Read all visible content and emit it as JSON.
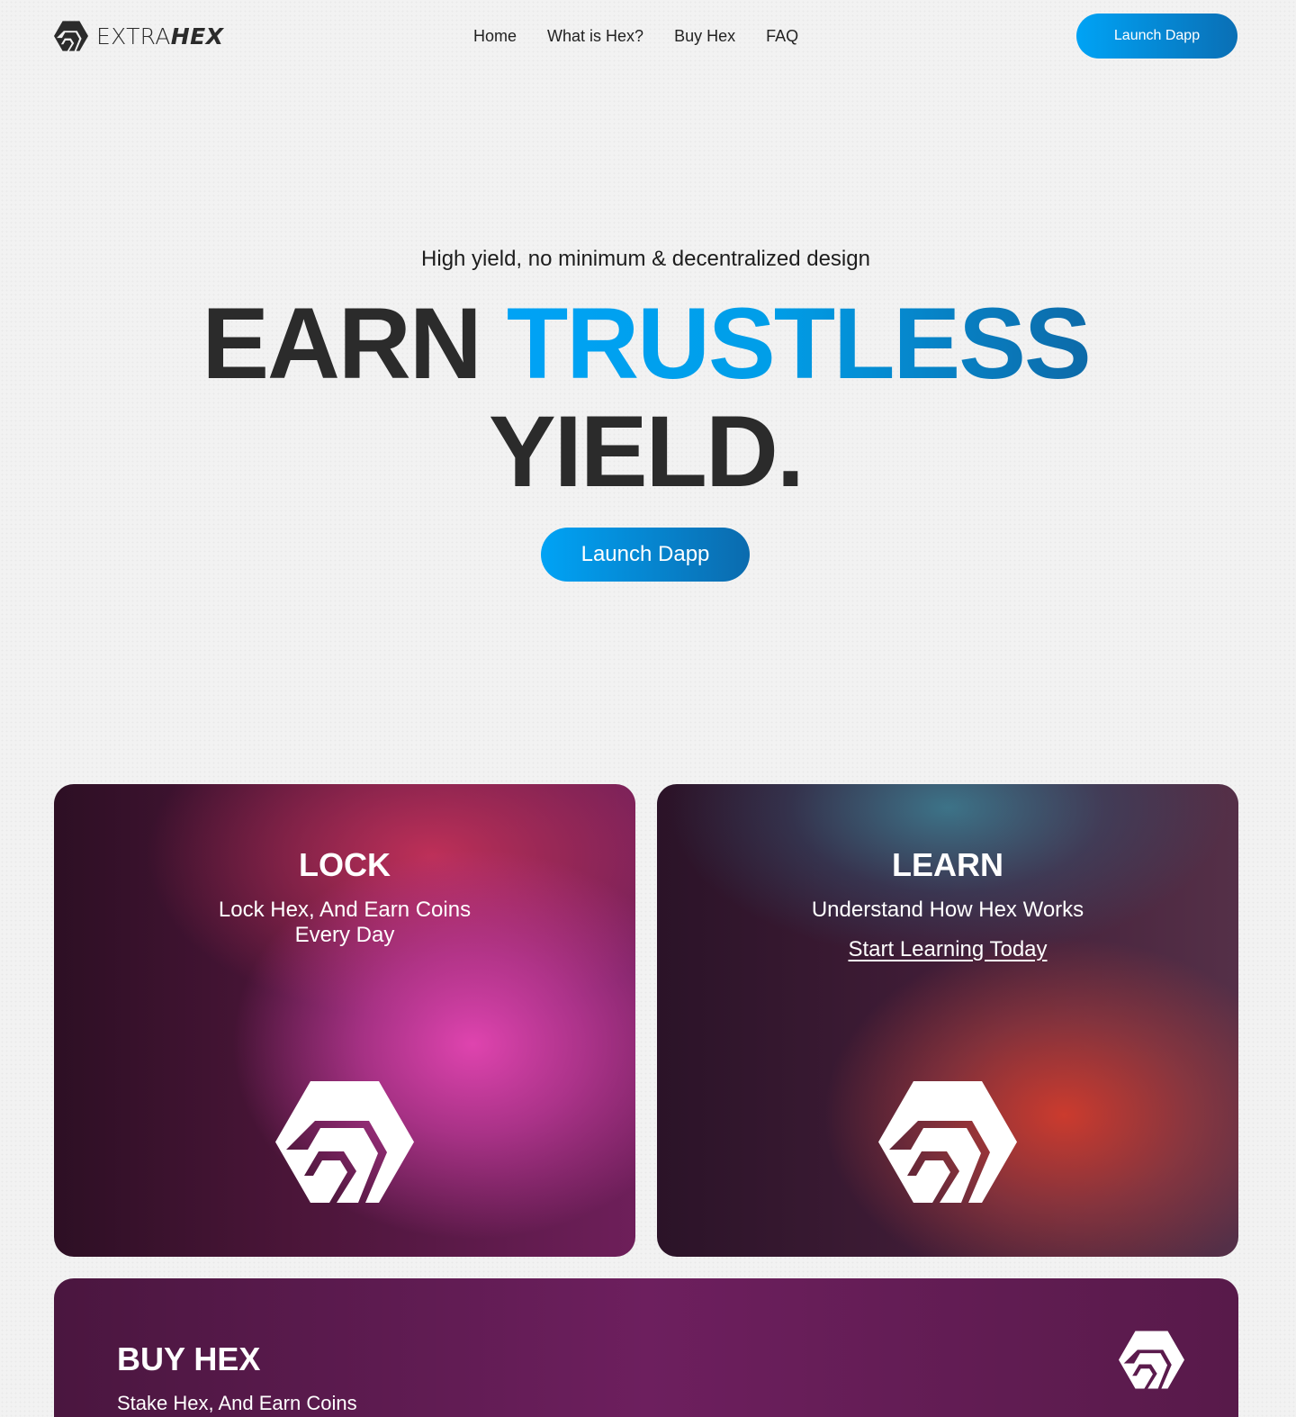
{
  "header": {
    "logo_light": "EXTRA",
    "logo_bold": "HEX",
    "logo_icon": "hex-logo-icon",
    "nav": [
      {
        "label": "Home"
      },
      {
        "label": "What is Hex?"
      },
      {
        "label": "Buy Hex"
      },
      {
        "label": "FAQ"
      }
    ],
    "launch_label": "Launch Dapp"
  },
  "hero": {
    "subtitle": "High yield, no minimum & decentralized design",
    "title_word1": "EARN",
    "title_word2": "TRUSTLESS",
    "title_word3": "YIELD.",
    "button_label": "Launch Dapp"
  },
  "cards": {
    "lock": {
      "title": "LOCK",
      "desc_line1": "Lock Hex, And Earn Coins",
      "desc_line2": "Every Day",
      "icon": "hex-logo-icon"
    },
    "learn": {
      "title": "LEARN",
      "desc": "Understand How Hex Works",
      "link": "Start Learning Today",
      "icon": "hex-logo-icon"
    },
    "buy": {
      "title": "BUY HEX",
      "desc": "Stake Hex, And Earn Coins",
      "icon": "hex-logo-icon"
    }
  },
  "colors": {
    "accent_start": "#00a3f5",
    "accent_end": "#0b6bae",
    "text_dark": "#2b2b2b",
    "background": "#f2f2f2"
  }
}
